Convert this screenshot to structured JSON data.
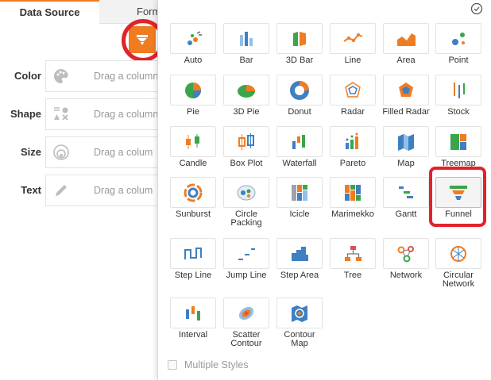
{
  "tabs": {
    "data_source": "Data Source",
    "format": "Form"
  },
  "fields": [
    {
      "label": "Color",
      "placeholder": "Drag a column",
      "icon": "palette-icon"
    },
    {
      "label": "Shape",
      "placeholder": "Drag a column",
      "icon": "shape-icon"
    },
    {
      "label": "Size",
      "placeholder": "Drag a colum",
      "icon": "size-icon"
    },
    {
      "label": "Text",
      "placeholder": "Drag a colum",
      "icon": "pencil-icon"
    }
  ],
  "chart_types": [
    {
      "label": "Auto",
      "icon": "auto-chart-icon"
    },
    {
      "label": "Bar",
      "icon": "bar-chart-icon"
    },
    {
      "label": "3D Bar",
      "icon": "3d-bar-chart-icon"
    },
    {
      "label": "Line",
      "icon": "line-chart-icon"
    },
    {
      "label": "Area",
      "icon": "area-chart-icon"
    },
    {
      "label": "Point",
      "icon": "point-chart-icon"
    },
    {
      "label": "Pie",
      "icon": "pie-chart-icon"
    },
    {
      "label": "3D Pie",
      "icon": "3d-pie-chart-icon"
    },
    {
      "label": "Donut",
      "icon": "donut-chart-icon"
    },
    {
      "label": "Radar",
      "icon": "radar-chart-icon"
    },
    {
      "label": "Filled Radar",
      "icon": "filled-radar-chart-icon"
    },
    {
      "label": "Stock",
      "icon": "stock-chart-icon"
    },
    {
      "label": "Candle",
      "icon": "candle-chart-icon"
    },
    {
      "label": "Box Plot",
      "icon": "box-plot-icon"
    },
    {
      "label": "Waterfall",
      "icon": "waterfall-chart-icon"
    },
    {
      "label": "Pareto",
      "icon": "pareto-chart-icon"
    },
    {
      "label": "Map",
      "icon": "map-chart-icon"
    },
    {
      "label": "Treemap",
      "icon": "treemap-chart-icon"
    },
    {
      "label": "Sunburst",
      "icon": "sunburst-chart-icon"
    },
    {
      "label": "Circle Packing",
      "icon": "circle-packing-icon"
    },
    {
      "label": "Icicle",
      "icon": "icicle-chart-icon"
    },
    {
      "label": "Marimekko",
      "icon": "marimekko-chart-icon"
    },
    {
      "label": "Gantt",
      "icon": "gantt-chart-icon"
    },
    {
      "label": "Funnel",
      "icon": "funnel-chart-icon"
    },
    {
      "label": "Step Line",
      "icon": "step-line-chart-icon"
    },
    {
      "label": "Jump Line",
      "icon": "jump-line-chart-icon"
    },
    {
      "label": "Step Area",
      "icon": "step-area-chart-icon"
    },
    {
      "label": "Tree",
      "icon": "tree-chart-icon"
    },
    {
      "label": "Network",
      "icon": "network-chart-icon"
    },
    {
      "label": "Circular Network",
      "icon": "circular-network-icon"
    },
    {
      "label": "Interval",
      "icon": "interval-chart-icon"
    },
    {
      "label": "Scatter Contour",
      "icon": "scatter-contour-icon"
    },
    {
      "label": "Contour Map",
      "icon": "contour-map-icon"
    }
  ],
  "selected_chart": "Funnel",
  "multiple_styles": {
    "label": "Multiple Styles",
    "checked": false
  },
  "colors": {
    "accent": "#f07c22",
    "highlight": "#e2222b",
    "blue": "#3f7fc2",
    "green": "#3aa54a",
    "teal": "#2aa7a1"
  }
}
